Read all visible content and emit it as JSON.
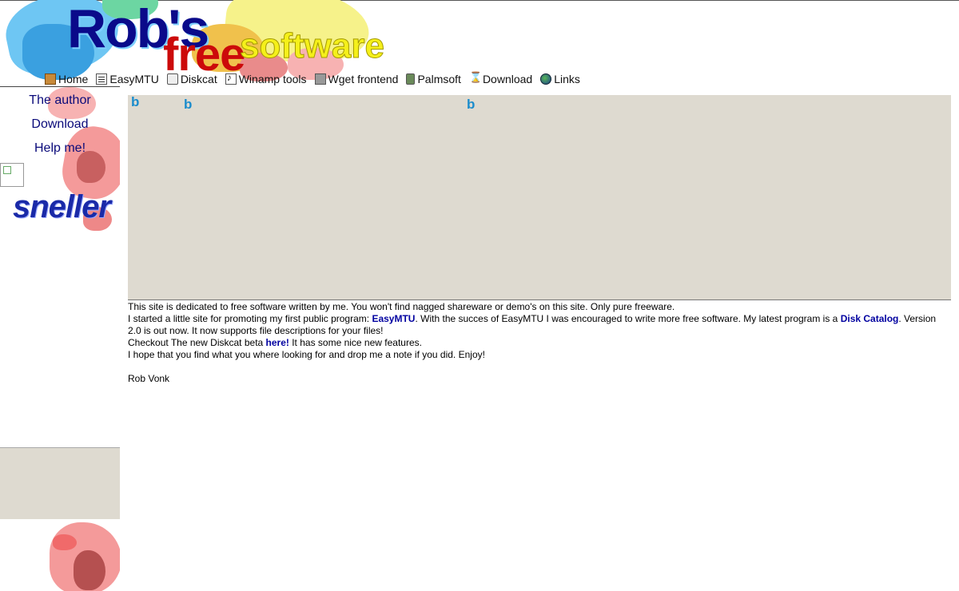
{
  "header": {
    "logo_robs": "Rob's",
    "logo_free": "free",
    "logo_software": "software"
  },
  "nav": {
    "items": [
      {
        "label": "Home",
        "icon": "box-icon"
      },
      {
        "label": "EasyMTU",
        "icon": "document-icon"
      },
      {
        "label": "Diskcat",
        "icon": "disk-icon"
      },
      {
        "label": "Winamp tools",
        "icon": "music-note-icon"
      },
      {
        "label": "Wget frontend",
        "icon": "network-icon"
      },
      {
        "label": "Palmsoft",
        "icon": "palm-device-icon"
      },
      {
        "label": "Download",
        "icon": "hourglass-icon"
      },
      {
        "label": "Links",
        "icon": "globe-icon"
      }
    ]
  },
  "sidebar": {
    "links": [
      "The author",
      "Download",
      "Help me!"
    ],
    "badge_text": "sneller"
  },
  "content": {
    "line1": "This site is dedicated to free software written by me. You won't find nagged shareware or demo's on this site. Only pure freeware.",
    "line2_pre": "I started a little site for promoting my first public program: ",
    "line2_link1": "EasyMTU",
    "line2_mid": ". With the succes of EasyMTU I was encouraged to write more free software. My latest program is a ",
    "line2_link2": "Disk Catalog",
    "line2_post": ". Version 2.0 is out now. It now supports file descriptions for your files!",
    "line3_pre": "Checkout The new Diskcat beta ",
    "line3_link": "here!",
    "line3_post": " It has some nice new features.",
    "line4": "I hope that you find what you where looking for and drop me a note if you did. Enjoy!",
    "signature": "Rob Vonk"
  },
  "colors": {
    "link": "#0000a0",
    "sidebar_link": "#0a0a7a",
    "banner_bg": "#dedad0"
  }
}
